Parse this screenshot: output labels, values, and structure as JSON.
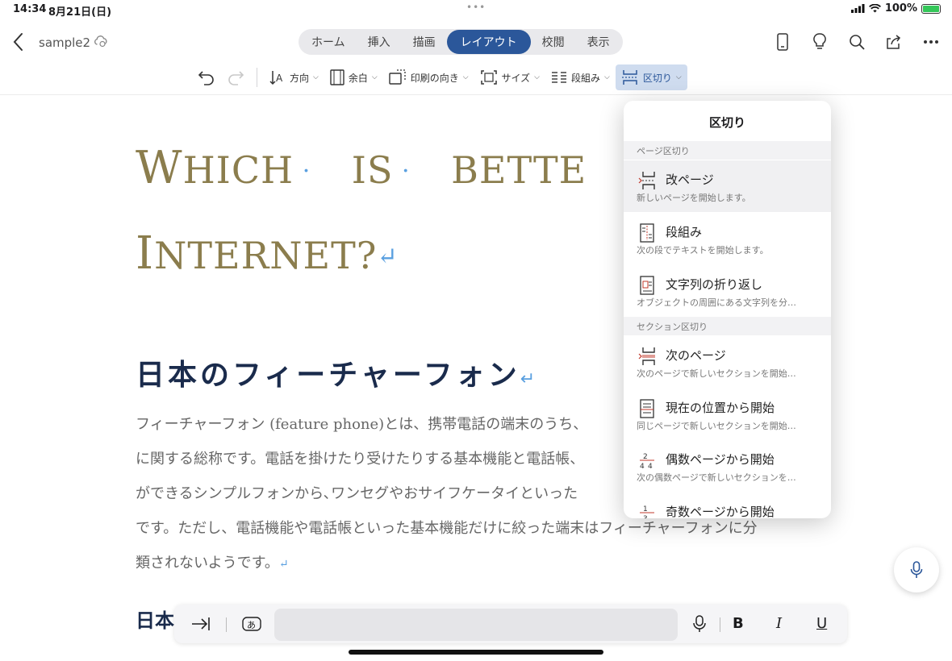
{
  "status": {
    "time": "14:34",
    "date": "8月21日(日)",
    "battery": "100%"
  },
  "titlebar": {
    "doc_title": "sample2"
  },
  "tabs": [
    {
      "label": "ホーム",
      "active": false
    },
    {
      "label": "挿入",
      "active": false
    },
    {
      "label": "描画",
      "active": false
    },
    {
      "label": "レイアウト",
      "active": true
    },
    {
      "label": "校閲",
      "active": false
    },
    {
      "label": "表示",
      "active": false
    }
  ],
  "toolbar": {
    "direction": "方向",
    "margin": "余白",
    "orientation": "印刷の向き",
    "size": "サイズ",
    "columns": "段組み",
    "breaks": "区切り"
  },
  "document": {
    "title_line1": [
      "W",
      "HICH",
      "IS",
      "BETTE"
    ],
    "title_line2": [
      "I",
      "NTERNET?"
    ],
    "heading1": "日本のフィーチャーフォン",
    "body": [
      "フィーチャーフォン (feature phone)とは、携帯電話の端末のうち、",
      "に関する総称です。電話を掛けたり受けたりする基本機能と電話帳、",
      "ができるシンプルフォンから､ワンセグやおサイフケータイといった",
      "です。ただし、電話機能や電話帳といった基本機能だけに絞った端末はフィーチャーフォンに分",
      "類されないようです。"
    ],
    "heading2": "日本"
  },
  "popover": {
    "title": "区切り",
    "sections": [
      {
        "header": "ページ区切り",
        "items": [
          {
            "label": "改ページ",
            "desc": "新しいページを開始します。",
            "selected": true
          },
          {
            "label": "段組み",
            "desc": "次の段でテキストを開始します。",
            "selected": false
          },
          {
            "label": "文字列の折り返し",
            "desc": "オブジェクトの周囲にある文字列を分…",
            "selected": false
          }
        ]
      },
      {
        "header": "セクション区切り",
        "items": [
          {
            "label": "次のページ",
            "desc": "次のページで新しいセクションを開始…",
            "selected": false
          },
          {
            "label": "現在の位置から開始",
            "desc": "同じページで新しいセクションを開始…",
            "selected": false
          },
          {
            "label": "偶数ページから開始",
            "desc": "次の偶数ページで新しいセクションを…",
            "selected": false
          },
          {
            "label": "奇数ページから開始",
            "desc": "",
            "selected": false
          }
        ]
      }
    ]
  },
  "keyboard_bar": {
    "bold": "B",
    "italic": "I",
    "underline": "U"
  },
  "colors": {
    "accent": "#2b579a",
    "title_gold": "#8b7d4d",
    "heading_navy": "#1a2b4c",
    "para_mark": "#5aa0e0"
  }
}
